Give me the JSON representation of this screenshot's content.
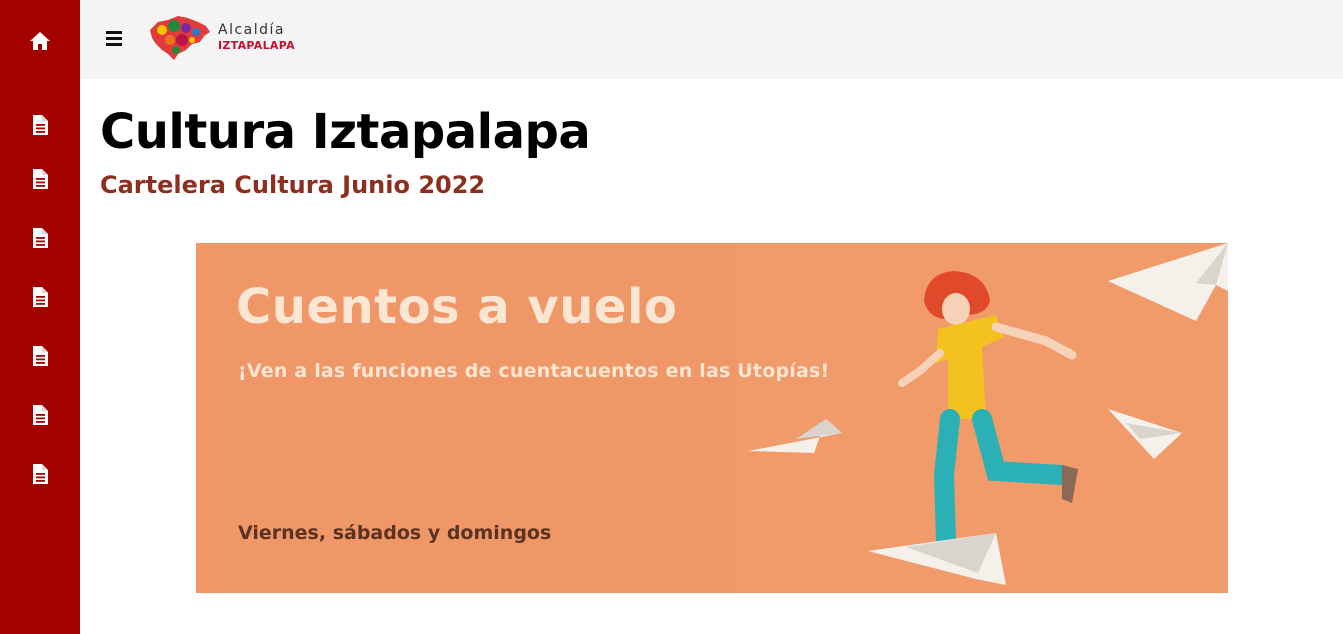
{
  "header": {
    "logo_line1": "Alcaldía",
    "logo_line2": "IZTAPALAPA"
  },
  "sidebar": {
    "items": [
      {
        "icon": "home-icon"
      },
      {
        "icon": "document-icon"
      },
      {
        "icon": "document-icon"
      },
      {
        "icon": "document-icon"
      },
      {
        "icon": "document-icon"
      },
      {
        "icon": "document-icon"
      },
      {
        "icon": "document-icon"
      },
      {
        "icon": "document-icon"
      }
    ]
  },
  "main": {
    "title": "Cultura Iztapalapa",
    "subtitle": "Cartelera Cultura Junio 2022"
  },
  "banner": {
    "title": "Cuentos a vuelo",
    "subtitle": "¡Ven a las funciones de cuentacuentos en las Utopías!",
    "days": "Viernes, sábados y domingos"
  },
  "colors": {
    "sidebar": "#a30000",
    "topbar": "#f4f4f4",
    "subtitle": "#8b2f1f",
    "banner_bg": "#ef9767"
  }
}
